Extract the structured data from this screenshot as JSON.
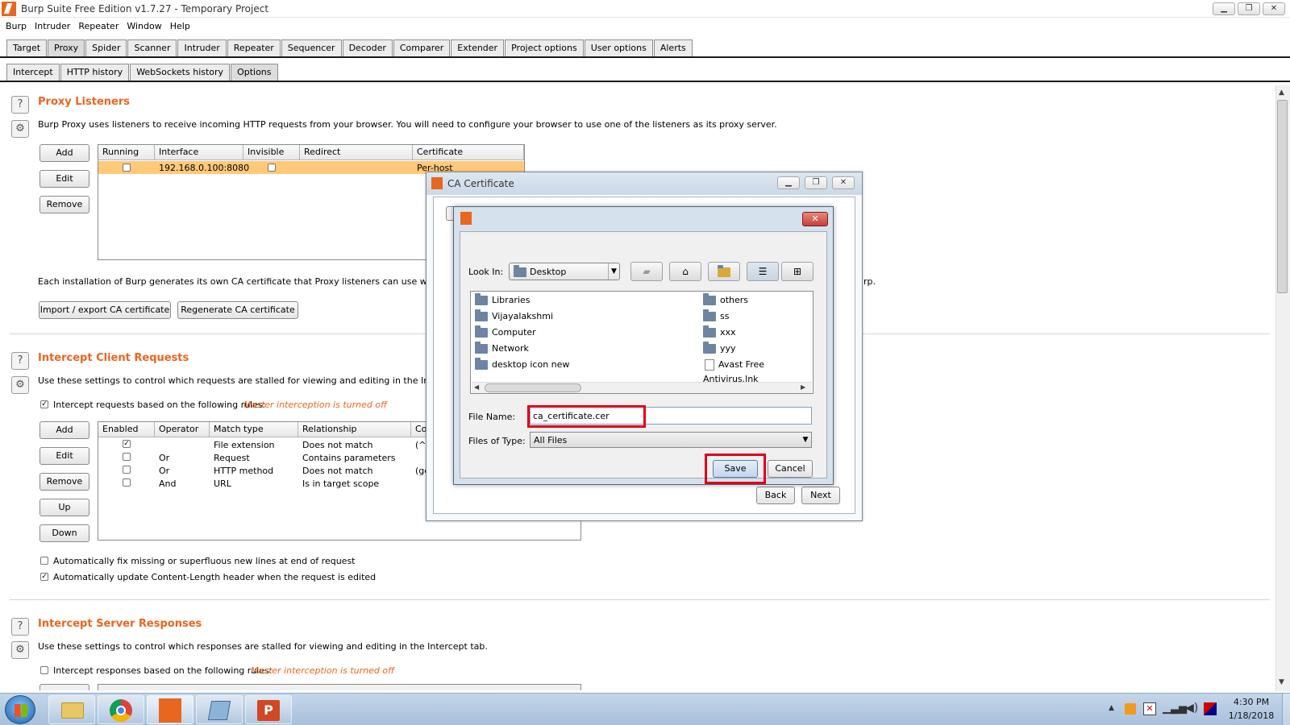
{
  "window": {
    "title": "Burp Suite Free Edition v1.7.27 - Temporary Project",
    "controls": [
      "▁",
      "❐",
      "✕"
    ]
  },
  "menu": [
    "Burp",
    "Intruder",
    "Repeater",
    "Window",
    "Help"
  ],
  "main_tabs": [
    "Target",
    "Proxy",
    "Spider",
    "Scanner",
    "Intruder",
    "Repeater",
    "Sequencer",
    "Decoder",
    "Comparer",
    "Extender",
    "Project options",
    "User options",
    "Alerts"
  ],
  "sub_tabs": [
    "Intercept",
    "HTTP history",
    "WebSockets history",
    "Options"
  ],
  "proxy_listeners": {
    "title": "Proxy Listeners",
    "description": "Burp Proxy uses listeners to receive incoming HTTP requests from your browser. You will need to configure your browser to use one of the listeners as its proxy server.",
    "buttons": [
      "Add",
      "Edit",
      "Remove"
    ],
    "columns": [
      "Running",
      "Interface",
      "Invisible",
      "Redirect",
      "Certificate"
    ],
    "row": {
      "interface": "192.168.0.100:8080",
      "certificate": "Per-host"
    },
    "ca_text": "Each installation of Burp generates its own CA certificate that Proxy listeners can use when negotia",
    "ca_text_tail": "rp.",
    "import_export_label": "Import / export CA certificate",
    "regenerate_label": "Regenerate CA certificate"
  },
  "intercept_client": {
    "title": "Intercept Client Requests",
    "description": "Use these settings to control which requests are stalled for viewing and editing in the Intercept tab.",
    "rule_checkbox_label": "Intercept requests based on the following rules:",
    "master_note": "Master interception is turned off",
    "buttons": [
      "Add",
      "Edit",
      "Remove",
      "Up",
      "Down"
    ],
    "columns": [
      "Enabled",
      "Operator",
      "Match type",
      "Relationship",
      "Co"
    ],
    "rows": [
      {
        "operator": "",
        "match_type": "File extension",
        "relationship": "Does not match",
        "condition": "(^g"
      },
      {
        "operator": "Or",
        "match_type": "Request",
        "relationship": "Contains parameters",
        "condition": ""
      },
      {
        "operator": "Or",
        "match_type": "HTTP method",
        "relationship": "Does not match",
        "condition": "(ge"
      },
      {
        "operator": "And",
        "match_type": "URL",
        "relationship": "Is in target scope",
        "condition": ""
      }
    ],
    "option_fix_newlines": "Automatically fix missing or superfluous new lines at end of request",
    "option_update_length": "Automatically update Content-Length header when the request is edited"
  },
  "intercept_server": {
    "title": "Intercept Server Responses",
    "description": "Use these settings to control which responses are stalled for viewing and editing in the Intercept tab.",
    "rule_checkbox_label": "Intercept responses based on the following rules:",
    "master_note": "Master interception is turned off"
  },
  "ca_dialog": {
    "title": "CA Certificate",
    "back_label": "Back",
    "next_label": "Next"
  },
  "save_dialog": {
    "look_in_label": "Look In:",
    "look_in_value": "Desktop",
    "files_left": [
      "Libraries",
      "Vijayalakshmi",
      "Computer",
      "Network",
      "desktop icon new"
    ],
    "files_right": [
      "others",
      "ss",
      "xxx",
      "yyy"
    ],
    "file_right_doc": "Avast Free Antivirus.lnk",
    "file_name_label": "File Name:",
    "file_name_value": "ca_certificate.cer",
    "files_of_type_label": "Files of Type:",
    "files_of_type_value": "All Files",
    "save_label": "Save",
    "cancel_label": "Cancel"
  },
  "taskbar": {
    "time": "4:30 PM",
    "date": "1/18/2018"
  },
  "colors": {
    "accent": "#e8661f",
    "highlight_row": "#ffc97a",
    "red_box": "#e0001a"
  }
}
